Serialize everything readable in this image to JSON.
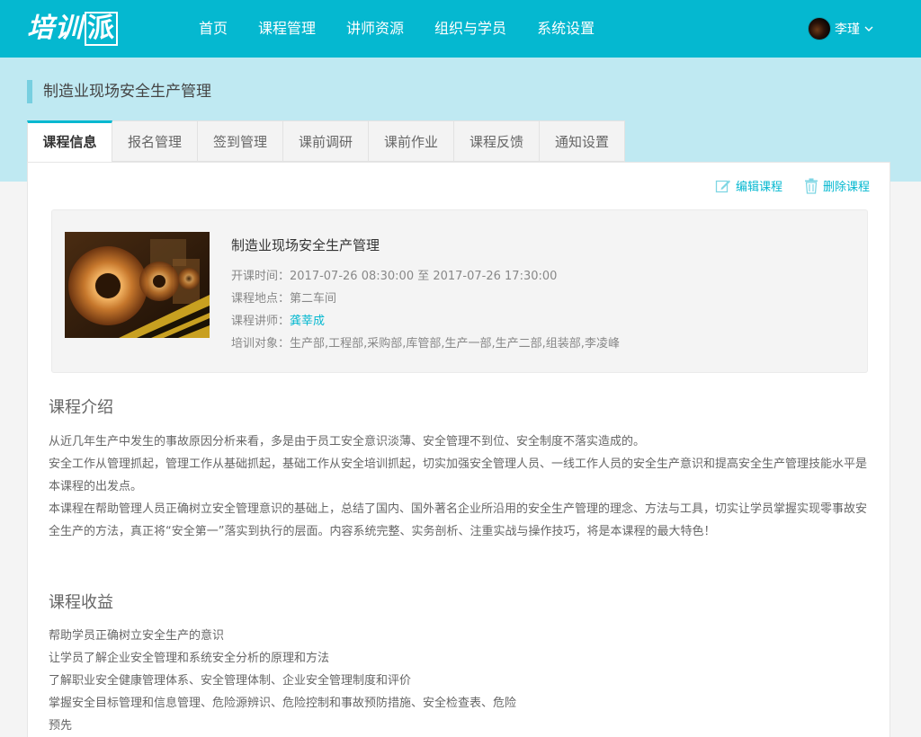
{
  "header": {
    "logo_text": "培训派",
    "nav": [
      "首页",
      "课程管理",
      "讲师资源",
      "组织与学员",
      "系统设置"
    ],
    "user_name": "李瑾"
  },
  "page": {
    "title": "制造业现场安全生产管理"
  },
  "tabs": [
    "课程信息",
    "报名管理",
    "签到管理",
    "课前调研",
    "课前作业",
    "课程反馈",
    "通知设置"
  ],
  "actions": {
    "edit_label": "编辑课程",
    "delete_label": "删除课程"
  },
  "course": {
    "name": "制造业现场安全生产管理",
    "time_label": "开课时间：",
    "time_value": "2017-07-26 08:30:00 至 2017-07-26 17:30:00",
    "location_label": "课程地点：",
    "location_value": "第二车间",
    "teacher_label": "课程讲师：",
    "teacher_value": "龚莘成",
    "audience_label": "培训对象：",
    "audience_value": "生产部,工程部,采购部,库管部,生产一部,生产二部,组装部,李凌峰"
  },
  "intro": {
    "title": "课程介绍",
    "paragraphs": [
      "从近几年生产中发生的事故原因分析来看，多是由于员工安全意识淡薄、安全管理不到位、安全制度不落实造成的。",
      "安全工作从管理抓起，管理工作从基础抓起，基础工作从安全培训抓起，切实加强安全管理人员、一线工作人员的安全生产意识和提高安全生产管理技能水平是本课程的出发点。",
      "本课程在帮助管理人员正确树立安全管理意识的基础上，总结了国内、国外著名企业所沿用的安全生产管理的理念、方法与工具，切实让学员掌握实现零事故安全生产的方法，真正将“安全第一”落实到执行的层面。内容系统完整、实务剖析、注重实战与操作技巧，将是本课程的最大特色！"
    ]
  },
  "benefits": {
    "title": "课程收益",
    "items": [
      "帮助学员正确树立安全生产的意识",
      " 让学员了解企业安全管理和系统安全分析的原理和方法",
      " 了解职业安全健康管理体系、安全管理体制、企业安全管理制度和评价",
      " 掌握安全目标管理和信息管理、危险源辨识、危险控制和事故预防措施、安全检查表、危险",
      " 预先"
    ]
  },
  "colors": {
    "primary": "#05b8d0",
    "band": "#bfe9f2",
    "title_bar": "#77cfe0"
  }
}
